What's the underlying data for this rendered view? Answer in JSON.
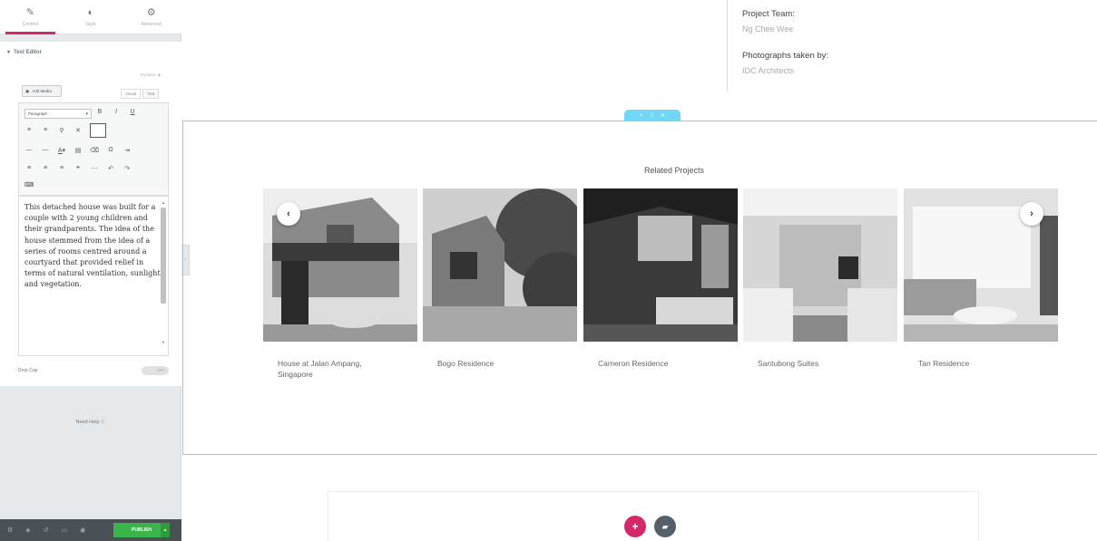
{
  "panel": {
    "tabs": [
      {
        "label": "Content",
        "icon": "pencil-icon"
      },
      {
        "label": "Style",
        "icon": "half-circle-icon"
      },
      {
        "label": "Advanced",
        "icon": "gear-icon"
      }
    ],
    "section_title": "Text Editor",
    "dynamic_tags": "Dynamic",
    "add_media": "Add Media",
    "visual_tab": "Visual",
    "text_tab": "Text",
    "format_select": "Paragraph",
    "editor_text": "This detached house was built for a couple with 2 young children and their grandparents. The idea of the house stemmed from the idea of a series of rooms centred around a courtyard that provided relief in terms of natural ventilation, sunlight and vegetation.",
    "drop_cap_label": "Drop Cap",
    "drop_cap_state": "OFF",
    "need_help": "Need Help",
    "publish": "PUBLISH"
  },
  "page": {
    "project_team_label": "Project Team:",
    "project_team_value": "Ng Chee Wee",
    "photos_label": "Photographs taken by:",
    "photos_value": "IDC Architects",
    "related_title": "Related Projects",
    "projects": [
      {
        "name": "House at Jalan Ampang, Singapore"
      },
      {
        "name": "Bogo Residence"
      },
      {
        "name": "Cameron Residence"
      },
      {
        "name": "Santubong Suites"
      },
      {
        "name": "Tan Residence"
      }
    ]
  },
  "colors": {
    "accent": "#d5286c",
    "selection": "#71d7f7",
    "publish": "#39b54a",
    "footer": "#495157"
  }
}
